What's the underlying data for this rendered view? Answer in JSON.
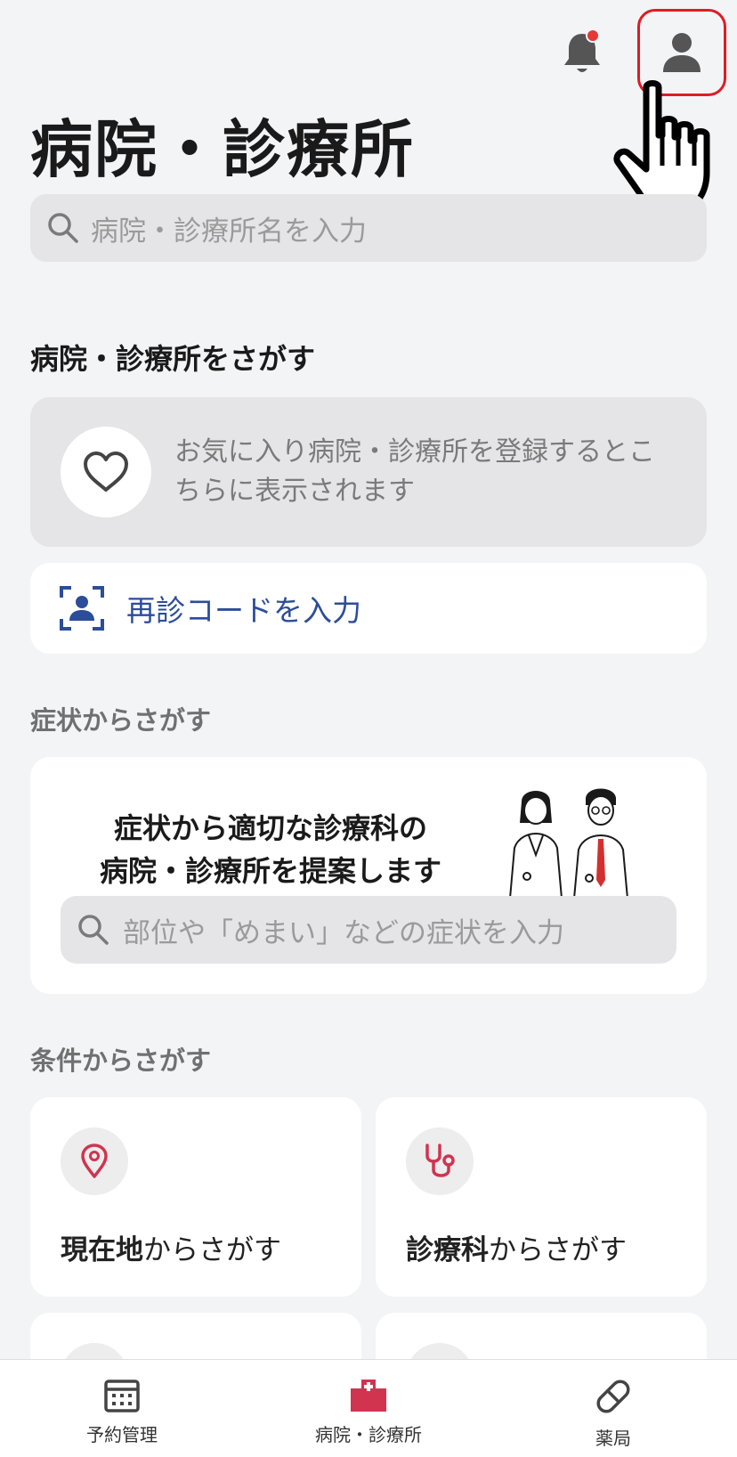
{
  "header": {
    "title": "病院・診療所",
    "notification_icon": "bell-icon",
    "profile_icon": "person-icon",
    "has_unread": true
  },
  "search": {
    "placeholder": "病院・診療所名を入力"
  },
  "find_section": {
    "title": "病院・診療所をさがす",
    "favorites_empty_text": "お気に入り病院・診療所を登録するとこちらに表示されます",
    "revisit_code_label": "再診コードを入力"
  },
  "symptom_section": {
    "title": "症状からさがす",
    "card_text_line1": "症状から適切な診療科の",
    "card_text_line2": "病院・診療所を提案します",
    "search_placeholder": "部位や「めまい」などの症状を入力"
  },
  "condition_section": {
    "title": "条件からさがす",
    "items": [
      {
        "bold": "現在地",
        "rest": "からさがす",
        "icon": "location-pin-icon"
      },
      {
        "bold": "診療科",
        "rest": "からさがす",
        "icon": "stethoscope-icon"
      }
    ]
  },
  "bottom_nav": {
    "items": [
      {
        "label": "予約管理",
        "icon": "calendar-icon"
      },
      {
        "label": "病院・診療所",
        "icon": "hospital-icon"
      },
      {
        "label": "薬局",
        "icon": "pill-icon"
      }
    ]
  },
  "colors": {
    "accent": "#d0344f",
    "link": "#2b4d9a",
    "highlight_border": "#e01b24",
    "background": "#f3f4f6"
  }
}
